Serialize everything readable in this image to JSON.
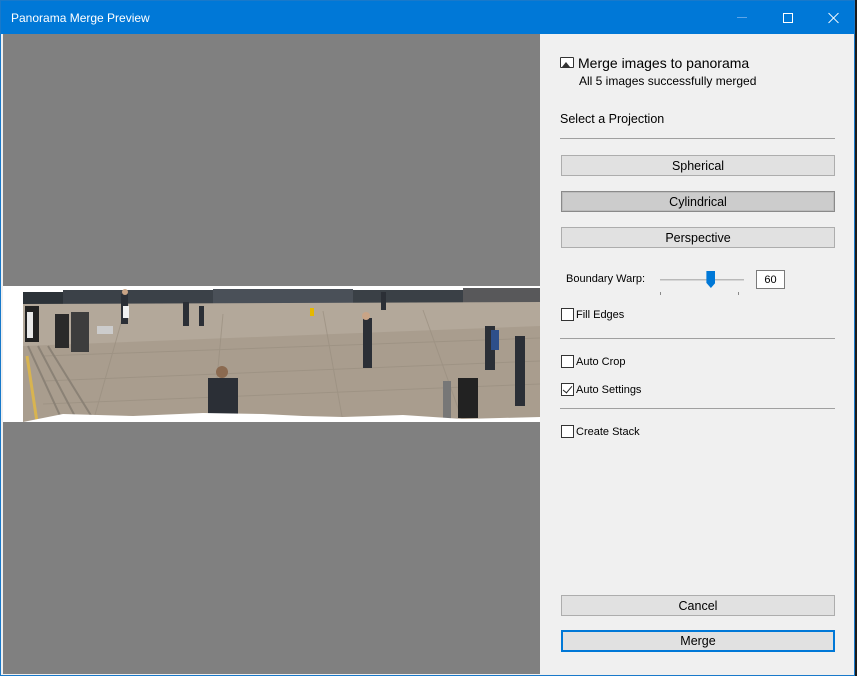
{
  "window": {
    "title": "Panorama Merge Preview"
  },
  "header": {
    "title": "Merge images to panorama",
    "subtitle": "All 5 images successfully merged"
  },
  "projection": {
    "label": "Select a Projection",
    "options": [
      "Spherical",
      "Cylindrical",
      "Perspective"
    ],
    "selected": "Cylindrical"
  },
  "boundary_warp": {
    "label": "Boundary Warp:",
    "value": "60",
    "fraction": 0.6
  },
  "fill_edges": {
    "label": "Fill Edges",
    "checked": false
  },
  "auto_crop": {
    "label": "Auto Crop",
    "checked": false
  },
  "auto_settings": {
    "label": "Auto Settings",
    "checked": true
  },
  "create_stack": {
    "label": "Create Stack",
    "checked": false
  },
  "actions": {
    "cancel": "Cancel",
    "merge": "Merge"
  },
  "colors": {
    "accent": "#0078d7",
    "preview_bg": "#808080",
    "panel_bg": "#f0f0f0"
  }
}
